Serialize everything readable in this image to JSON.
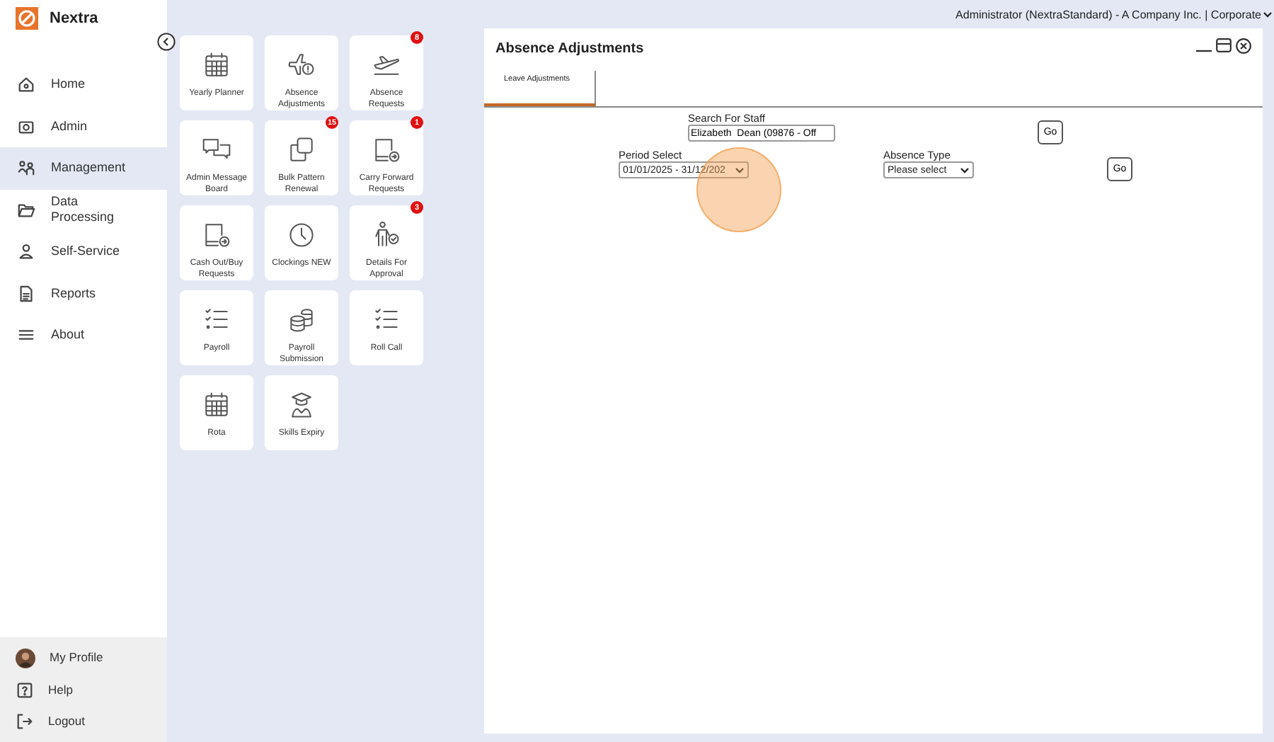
{
  "app": {
    "name": "Nextra"
  },
  "sidebar": {
    "items": [
      {
        "label": "Home",
        "selected": false
      },
      {
        "label": "Admin",
        "selected": false
      },
      {
        "label": "Management",
        "selected": true
      },
      {
        "label": "Data Processing",
        "selected": false
      },
      {
        "label": "Self-Service",
        "selected": false
      },
      {
        "label": "Reports",
        "selected": false
      },
      {
        "label": "About",
        "selected": false
      }
    ],
    "footer": [
      {
        "label": "My Profile"
      },
      {
        "label": "Help"
      },
      {
        "label": "Logout"
      }
    ]
  },
  "tiles": [
    {
      "label": "Yearly Planner"
    },
    {
      "label": "Absence Adjustments"
    },
    {
      "label": "Absence Requests",
      "badge": "8"
    },
    {
      "label": "Admin Message Board"
    },
    {
      "label": "Bulk Pattern Renewal",
      "badge": "15"
    },
    {
      "label": "Carry Forward Requests",
      "badge": "1"
    },
    {
      "label": "Cash Out/Buy Requests"
    },
    {
      "label": "Clockings NEW"
    },
    {
      "label": "Details For Approval",
      "badge": "3"
    },
    {
      "label": "Payroll"
    },
    {
      "label": "Payroll Submission"
    },
    {
      "label": "Roll Call"
    },
    {
      "label": "Rota"
    },
    {
      "label": "Skills Expiry"
    }
  ],
  "header": {
    "user": "Administrator (NextraStandard) - A Company Inc. | Corporate"
  },
  "window": {
    "title": "Absence Adjustments",
    "tabs": [
      {
        "label": "Leave Adjustments",
        "selected": true
      }
    ],
    "search_staff": {
      "label": "Search For Staff",
      "value": "Elizabeth  Dean (09876 - Off",
      "button": "Go"
    },
    "period_select": {
      "label": "Period Select",
      "value": "01/01/2025 - 31/12/202"
    },
    "absence_type": {
      "label": "Absence Type",
      "value": "Please select",
      "button": "Go"
    }
  }
}
